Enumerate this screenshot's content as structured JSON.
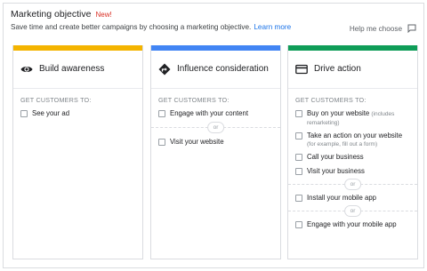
{
  "header": {
    "title": "Marketing objective",
    "new_badge": "New!",
    "subtitle": "Save time and create better campaigns by choosing a marketing objective.",
    "learn_more": "Learn more",
    "help": "Help me choose"
  },
  "colors": {
    "awareness": "#f4b400",
    "consideration": "#4285f4",
    "action": "#0f9d58",
    "link": "#1a73e8",
    "new_badge": "#d93025"
  },
  "cards": [
    {
      "name": "Build awareness",
      "icon": "eye-icon",
      "section": "GET CUSTOMERS TO:",
      "options": [
        {
          "label": "See your ad"
        }
      ]
    },
    {
      "name": "Influence consideration",
      "icon": "diamond-arrow-icon",
      "section": "GET CUSTOMERS TO:",
      "options": [
        {
          "label": "Engage with your content"
        },
        {
          "label": "Visit your website"
        }
      ],
      "or_label": "or"
    },
    {
      "name": "Drive action",
      "icon": "credit-card-icon",
      "section": "GET CUSTOMERS TO:",
      "options": [
        {
          "label": "Buy on your website",
          "sub": "(includes remarketing)"
        },
        {
          "label": "Take an action on your website",
          "sub": "(for example, fill out a form)"
        },
        {
          "label": "Call your business"
        },
        {
          "label": "Visit your business"
        },
        {
          "label": "Install your mobile app"
        },
        {
          "label": "Engage with your mobile app"
        }
      ],
      "or_label": "or"
    }
  ]
}
